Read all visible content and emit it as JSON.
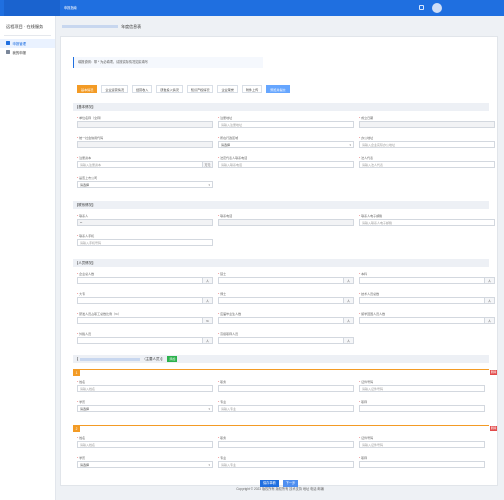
{
  "topbar": {
    "nav_label": "申报指南"
  },
  "sidebar": {
    "title": "远程项目 · 在线服务",
    "items": [
      {
        "label": "申报管理"
      },
      {
        "label": "我的申报"
      }
    ]
  },
  "crumb": {
    "suffix": "年度信息表"
  },
  "notice": "填报说明：带 * 为必填项，请按实际情况如实填写",
  "tabs": [
    "基本情况",
    "企业运营情况",
    "经营收入",
    "研发投入情况",
    "知识产权情况",
    "企业荣誉",
    "附件上传",
    "预览并提交"
  ],
  "sections": {
    "basic": "【基本情况】",
    "contact": "【联系情况】",
    "staff": "【人员情况】",
    "members_suffix": "（主要人员）",
    "add_button": "添加"
  },
  "basic": {
    "company_name": {
      "label": "单位名称（全称）",
      "placeholder": ""
    },
    "reg_address": {
      "label": "注册地址",
      "placeholder": "请输入注册地址"
    },
    "reg_date": {
      "label": "成立日期",
      "placeholder": ""
    },
    "credit_code": {
      "label": "统一社会信用代码",
      "placeholder": ""
    },
    "district": {
      "label": "所在行政区域",
      "value": "请选择"
    },
    "office_address": {
      "label": "办公地址",
      "placeholder": "请输入企业实际办公地址"
    },
    "reg_capital": {
      "label": "注册资本",
      "placeholder": "请输入注册资本",
      "unit": "万元"
    },
    "legal_contact": {
      "label": "法定代表人联系电话",
      "placeholder": "请输入联系电话"
    },
    "legal_person": {
      "label": "法人代表",
      "placeholder": "请输入法人代表"
    },
    "listed": {
      "label": "是否上市公司",
      "value": "请选择"
    }
  },
  "contact": {
    "contact_name": {
      "label": "联系人",
      "value": "**"
    },
    "contact_phone": {
      "label": "联系电话",
      "value": ""
    },
    "contact_email": {
      "label": "联系人电子邮箱",
      "placeholder": "请输入联系人电子邮箱"
    },
    "mobile": {
      "label": "联系人手机",
      "placeholder": "请输入手机号码"
    }
  },
  "staff": {
    "total": {
      "label": "企业总人数",
      "unit": "人"
    },
    "master": {
      "label": "硕士",
      "unit": "人"
    },
    "bachelor": {
      "label": "本科",
      "unit": "人"
    },
    "college": {
      "label": "大专",
      "unit": "人"
    },
    "phd": {
      "label": "博士",
      "unit": "人"
    },
    "tech": {
      "label": "技术人员总数",
      "unit": "人"
    },
    "rd_ratio": {
      "label": "研发人员占职工总数比例（%）",
      "unit": "%"
    },
    "graduates": {
      "label": "应届毕业生人数",
      "unit": "人"
    },
    "returnees": {
      "label": "留学回国人员人数",
      "unit": "人"
    },
    "foreign": {
      "label": "外籍人员",
      "unit": "人"
    },
    "senior": {
      "label": "高级职称人员",
      "unit": "人"
    }
  },
  "member_form": {
    "name": {
      "label": "姓名",
      "placeholder": "请输入姓名"
    },
    "position": {
      "label": "职务",
      "placeholder": ""
    },
    "id_no": {
      "label": "证件号码",
      "placeholder": "请输入证件号码"
    },
    "education": {
      "label": "学历",
      "value": "请选择"
    },
    "major": {
      "label": "专业",
      "placeholder": "请输入专业"
    },
    "title": {
      "label": "职称",
      "placeholder": ""
    }
  },
  "members": [
    {
      "index": "1",
      "delete": "删除"
    },
    {
      "index": "2",
      "delete": "删除"
    }
  ],
  "actions": {
    "save": "保存草稿",
    "next": "下一步"
  },
  "footer": "Copyright © 2023 版权所有 版权所有 技术支持  地址 电话 邮编"
}
